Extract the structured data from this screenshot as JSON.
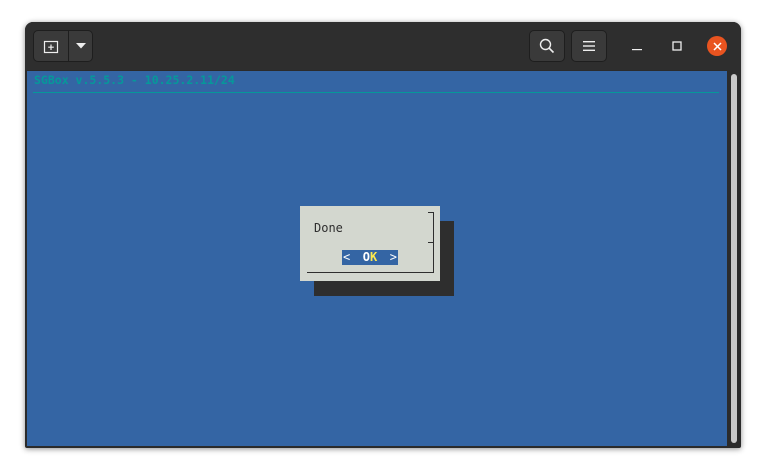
{
  "colors": {
    "terminal_bg": "#3465a4",
    "title_text": "#06989a",
    "dialog_bg": "#d3d7cf",
    "close_button": "#e95420",
    "hotkey": "#fce94f"
  },
  "headerbar": {
    "new_tab_icon": "new-tab-icon",
    "dropdown_icon": "chevron-down-icon",
    "search_icon": "search-icon",
    "menu_icon": "hamburger-menu-icon"
  },
  "terminal": {
    "title_line": "SGBox v.5.5.3 - 10.25.2.11/24"
  },
  "dialog": {
    "message": "Done",
    "button": {
      "left_bracket": "<",
      "label_prefix": "O",
      "label_hotkey": "K",
      "right_bracket": ">"
    }
  }
}
